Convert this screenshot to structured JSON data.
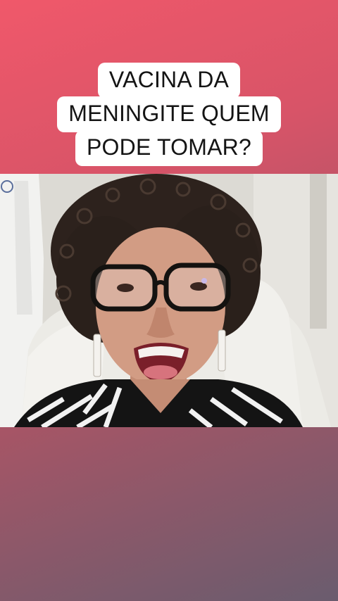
{
  "caption": {
    "lines": [
      "VACINA DA",
      "MENINGITE QUEM",
      "PODE TOMAR?"
    ]
  },
  "video": {
    "icon": "person-speaking-video-frame"
  },
  "colors": {
    "gradient_top": "#f0586a",
    "gradient_bottom": "#6a5c6e",
    "caption_bg": "#ffffff",
    "caption_text": "#141414"
  }
}
